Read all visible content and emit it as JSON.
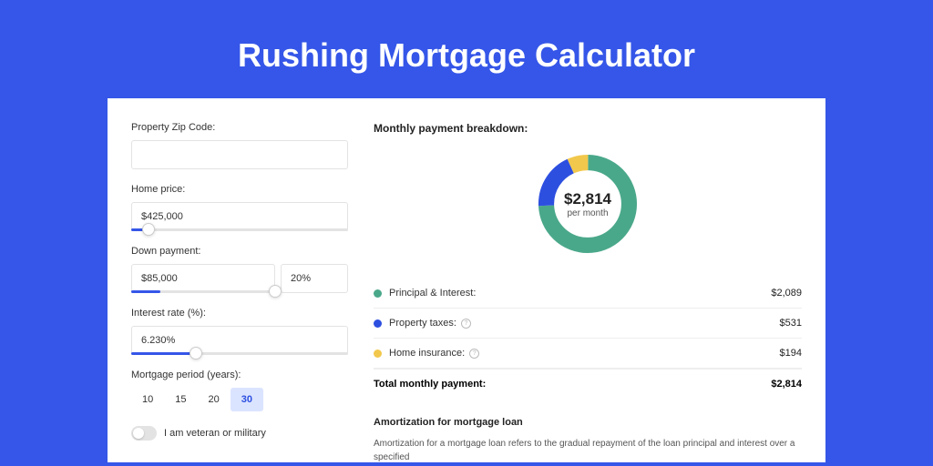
{
  "title": "Rushing Mortgage Calculator",
  "form": {
    "zip_label": "Property Zip Code:",
    "zip_value": "",
    "home_price_label": "Home price:",
    "home_price_value": "$425,000",
    "down_label": "Down payment:",
    "down_value": "$85,000",
    "down_pct": "20%",
    "rate_label": "Interest rate (%):",
    "rate_value": "6.230%",
    "period_label": "Mortgage period (years):",
    "periods": [
      "10",
      "15",
      "20",
      "30"
    ],
    "period_selected": "30",
    "veteran_label": "I am veteran or military"
  },
  "breakdown": {
    "title": "Monthly payment breakdown:",
    "total_amount": "$2,814",
    "per_month": "per month",
    "items": [
      {
        "label": "Principal & Interest:",
        "value": "$2,089",
        "color": "green"
      },
      {
        "label": "Property taxes:",
        "value": "$531",
        "color": "blue",
        "info": true
      },
      {
        "label": "Home insurance:",
        "value": "$194",
        "color": "yellow",
        "info": true
      }
    ],
    "total_label": "Total monthly payment:",
    "total_value": "$2,814"
  },
  "amort": {
    "title": "Amortization for mortgage loan",
    "text": "Amortization for a mortgage loan refers to the gradual repayment of the loan principal and interest over a specified"
  },
  "chart_data": {
    "type": "pie",
    "title": "Monthly payment breakdown",
    "series": [
      {
        "name": "Principal & Interest",
        "value": 2089,
        "color": "#4aa88a"
      },
      {
        "name": "Property taxes",
        "value": 531,
        "color": "#2d4fe0"
      },
      {
        "name": "Home insurance",
        "value": 194,
        "color": "#f2c84c"
      }
    ],
    "total": 2814
  },
  "sliders": {
    "home_price_pct": 8,
    "down_pct": 20,
    "rate_pct": 30
  }
}
